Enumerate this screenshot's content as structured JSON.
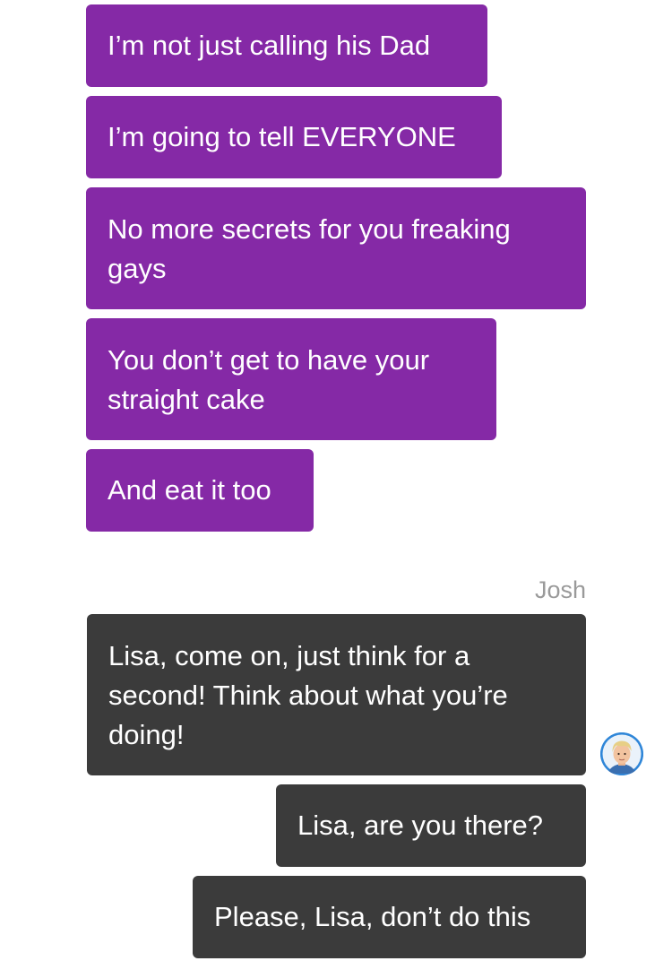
{
  "incoming_messages": [
    {
      "text": "I’m not just calling his Dad"
    },
    {
      "text": "I’m going to tell EVERYONE"
    },
    {
      "text": "No more secrets for you freaking gays"
    },
    {
      "text": "You don’t get to have your straight cake"
    },
    {
      "text": "And eat it too"
    }
  ],
  "sender": {
    "name": "Josh",
    "avatar_icon": "user-avatar-icon"
  },
  "outgoing_messages": [
    {
      "text": "Lisa, come on, just think for a second! Think about what you’re doing!"
    },
    {
      "text": "Lisa, are you there?"
    },
    {
      "text": "Please, Lisa, don’t do this"
    }
  ],
  "colors": {
    "incoming_bubble": "#8529a6",
    "outgoing_bubble": "#3b3b3b",
    "sender_name": "#9a9a9a",
    "background": "#ffffff"
  }
}
